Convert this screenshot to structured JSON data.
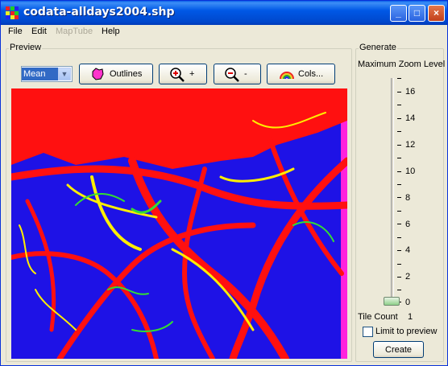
{
  "window": {
    "title": "codata-alldays2004.shp",
    "minimize": "_",
    "maximize": "□",
    "close": "×"
  },
  "menu": {
    "file": "File",
    "edit": "Edit",
    "maptube": "MapTube",
    "help": "Help"
  },
  "preview": {
    "group_label": "Preview",
    "mode_select": "Mean",
    "outlines_label": "Outlines",
    "zoom_in_label": "+",
    "zoom_out_label": "-",
    "cols_label": "Cols..."
  },
  "generate": {
    "group_label": "Generate",
    "zoom_label": "Maximum Zoom Level",
    "ticks": [
      "16",
      "14",
      "12",
      "10",
      "8",
      "6",
      "4",
      "2",
      "0"
    ],
    "zoom_level": 0,
    "tile_count_label": "Tile Count",
    "tile_count_value": "1",
    "limit_label": "Limit to preview",
    "create_label": "Create"
  },
  "colors": {
    "title_bar": "#0054e3",
    "map_background": "#1e12e6",
    "dense": "#ff1010",
    "medium": "#ffee00",
    "sparse": "#33dd33"
  }
}
